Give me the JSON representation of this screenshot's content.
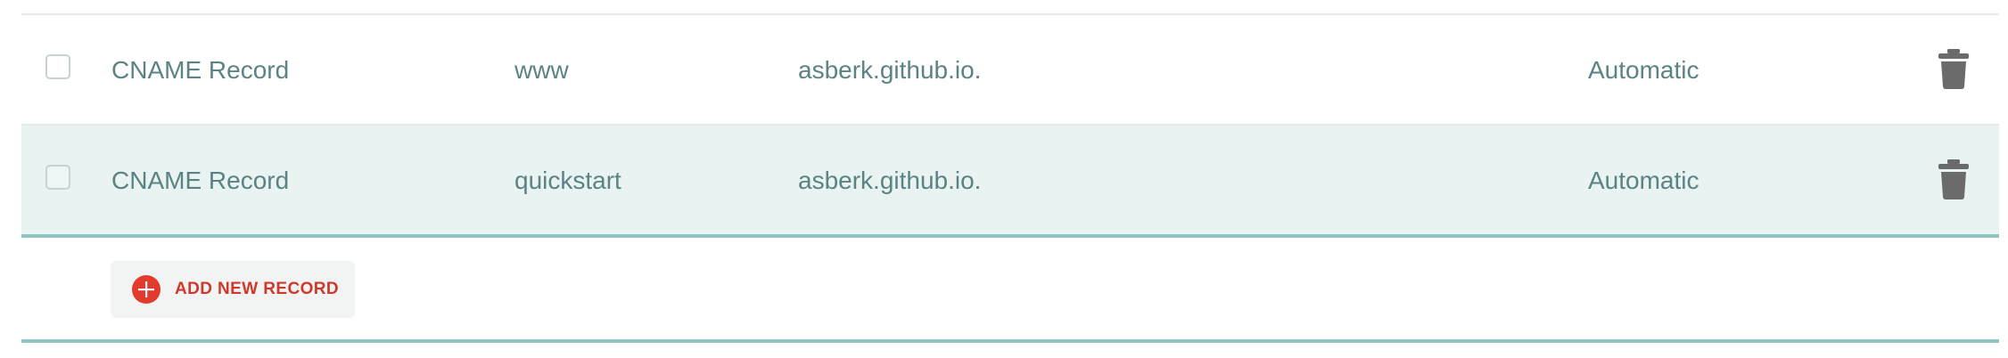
{
  "records": [
    {
      "type": "CNAME Record",
      "host": "www",
      "value": "asberk.github.io.",
      "ttl": "Automatic",
      "highlighted": false
    },
    {
      "type": "CNAME Record",
      "host": "quickstart",
      "value": "asberk.github.io.",
      "ttl": "Automatic",
      "highlighted": true
    }
  ],
  "actions": {
    "add_new_record_label": "ADD NEW RECORD"
  },
  "colors": {
    "text": "#5b8384",
    "highlight_row": "#e8f3f2",
    "accent_red": "#d0382c",
    "teal_line": "#8fc6c4",
    "trash_icon": "#6b6b6b"
  },
  "icons": {
    "row_delete": "trash-icon",
    "add": "plus-circle-icon"
  }
}
